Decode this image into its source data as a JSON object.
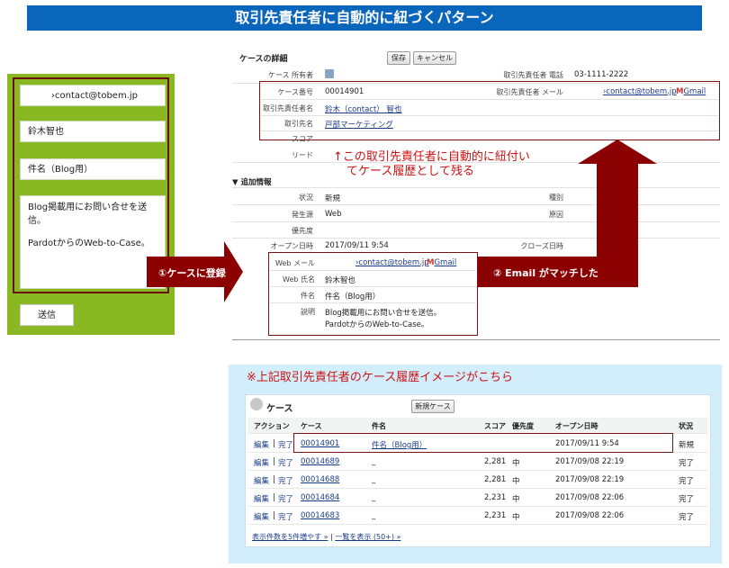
{
  "title": "取引先責任者に自動的に紐づくパターン",
  "form": {
    "email": "›contact@tobem.jp",
    "name": "鈴木智也",
    "subject": "件名（Blog用）",
    "message_line1": "Blog掲載用にお問い合せを送信。",
    "message_line2": "PardotからのWeb-to-Case。",
    "submit_label": "送信"
  },
  "detail": {
    "header": "ケースの詳細",
    "save_label": "保存",
    "cancel_label": "キャンセル",
    "owner_label": "ケース 所有者",
    "contact_phone_label": "取引先責任者 電話",
    "contact_phone": "03-1111-2222",
    "case_no_label": "ケース番号",
    "case_no": "00014901",
    "contact_email_label": "取引先責任者 メール",
    "contact_email": "›contact@tobem.jp",
    "gmail": "Gmail",
    "contact_name_label": "取引先責任者名",
    "contact_name": "鈴木（contact） 智也",
    "account_label": "取引先名",
    "account": "戸部マーケティング",
    "score_label": "スコア",
    "lead_label": "リード",
    "additional_label": "追加情報",
    "status_label": "状況",
    "status": "新規",
    "type_label": "種別",
    "origin_label": "発生源",
    "origin": "Web",
    "reason_label": "原因",
    "priority_label": "優先度",
    "open_date_label": "オープン日時",
    "open_date": "2017/09/11 9:54",
    "close_date_label": "クローズ日時",
    "web_email_label": "Web メール",
    "web_email": "›contact@tobem.jp",
    "web_name_label": "Web 氏名",
    "web_name": "鈴木智也",
    "subject_label": "件名",
    "subject": "件名（Blog用）",
    "desc_label": "説明",
    "desc_line1": "Blog掲載用にお問い合せを送信。",
    "desc_line2": "PardotからのWeb-to-Case。"
  },
  "annotations": {
    "auto_link_line1": "↑この取引先責任者に自動的に紐付い",
    "auto_link_line2": "てケース履歴として残る",
    "step1": "①ケースに登録",
    "step2": "② Email がマッチした",
    "history_note": "※上記取引先責任者のケース履歴イメージがこちら"
  },
  "cases": {
    "heading": "ケース",
    "new_button": "新規ケース",
    "columns": [
      "アクション",
      "ケース",
      "件名",
      "スコア",
      "優先度",
      "オープン日時",
      "状況"
    ],
    "rows": [
      {
        "edit": "編集",
        "sep": "|",
        "close": "完了",
        "case": "00014901",
        "subject": "件名（Blog用）",
        "score": "",
        "priority": "",
        "opened": "2017/09/11 9:54",
        "status": "新規"
      },
      {
        "edit": "編集",
        "sep": "|",
        "close": "完了",
        "case": "00014689",
        "subject": "_",
        "score": "2,281",
        "priority": "中",
        "opened": "2017/09/08 22:19",
        "status": "完了"
      },
      {
        "edit": "編集",
        "sep": "|",
        "close": "完了",
        "case": "00014688",
        "subject": "_",
        "score": "2,281",
        "priority": "中",
        "opened": "2017/09/08 22:19",
        "status": "完了"
      },
      {
        "edit": "編集",
        "sep": "|",
        "close": "完了",
        "case": "00014684",
        "subject": "_",
        "score": "2,231",
        "priority": "中",
        "opened": "2017/09/08 22:06",
        "status": "完了"
      },
      {
        "edit": "編集",
        "sep": "|",
        "close": "完了",
        "case": "00014683",
        "subject": "_",
        "score": "2,231",
        "priority": "中",
        "opened": "2017/09/08 22:06",
        "status": "完了"
      }
    ],
    "show_more": "表示件数を5件増やす »",
    "sep": "|",
    "show_all": "一覧を表示 (50+) »"
  },
  "colors": {
    "title_bg": "#0a66bb",
    "form_green": "#8ab822",
    "arrow": "#8b0000",
    "annot_red": "#cc1111",
    "list_bg": "#d3eefb"
  }
}
